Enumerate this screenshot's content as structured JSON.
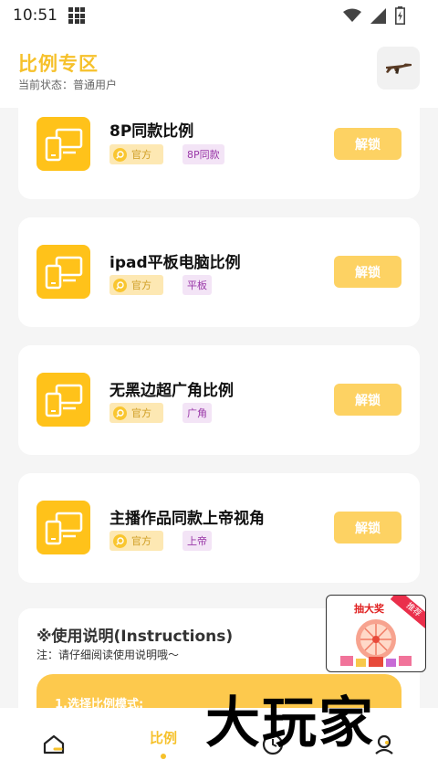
{
  "status_bar": {
    "time": "10:51"
  },
  "header": {
    "title": "比例专区",
    "state": "当前状态：普通用户"
  },
  "cards": [
    {
      "title": "8P同款比例",
      "official": "官方",
      "tag": "8P同款",
      "button": "解锁"
    },
    {
      "title": "ipad平板电脑比例",
      "official": "官方",
      "tag": "平板",
      "button": "解锁"
    },
    {
      "title": "无黑边超广角比例",
      "official": "官方",
      "tag": "广角",
      "button": "解锁"
    },
    {
      "title": "主播作品同款上帝视角",
      "official": "官方",
      "tag": "上帝",
      "button": "解锁"
    }
  ],
  "instructions": {
    "title": "※使用说明(Instructions)",
    "note": "注：请仔细阅读使用说明哦～",
    "step1": "1.选择比例模式:"
  },
  "promo": {
    "label": "抽大奖",
    "ribbon": "推荐"
  },
  "bottom_nav": {
    "center_label": "比例"
  },
  "watermark": "大玩家",
  "colors": {
    "accent": "#f6c12b",
    "icon_bg": "#ffc21a",
    "button": "#fdd263"
  }
}
